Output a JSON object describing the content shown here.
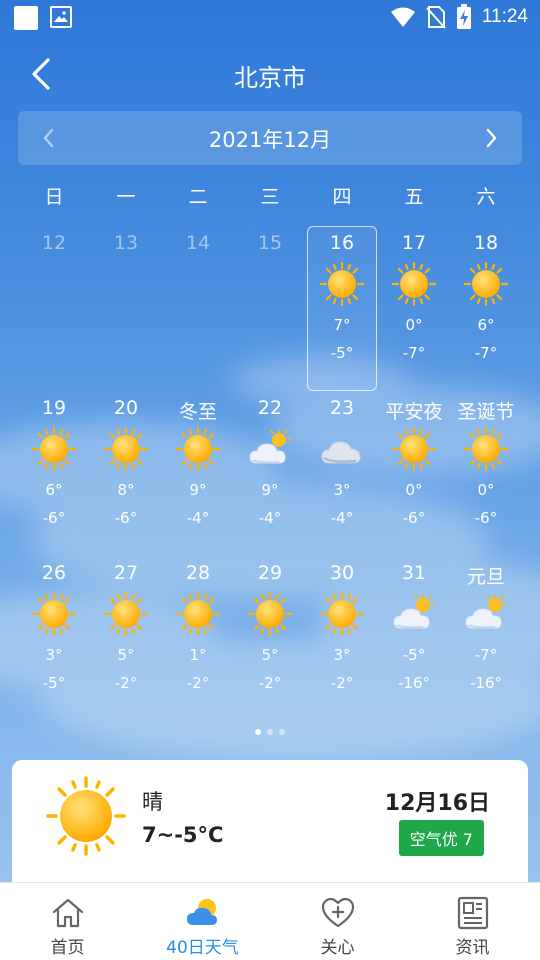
{
  "status_bar": {
    "time": "11:24"
  },
  "header": {
    "title": "北京市"
  },
  "calendar": {
    "month_label": "2021年12月",
    "weekdays": [
      "日",
      "一",
      "二",
      "三",
      "四",
      "五",
      "六"
    ],
    "days": [
      {
        "label": "12",
        "past": true
      },
      {
        "label": "13",
        "past": true
      },
      {
        "label": "14",
        "past": true
      },
      {
        "label": "15",
        "past": true
      },
      {
        "label": "16",
        "icon": "sun-icon",
        "high": "7°",
        "low": "-5°",
        "selected": true
      },
      {
        "label": "17",
        "icon": "sun-icon",
        "high": "0°",
        "low": "-7°"
      },
      {
        "label": "18",
        "icon": "sun-icon",
        "high": "6°",
        "low": "-7°"
      },
      {
        "label": "19",
        "icon": "sun-icon",
        "high": "6°",
        "low": "-6°"
      },
      {
        "label": "20",
        "icon": "sun-icon",
        "high": "8°",
        "low": "-6°"
      },
      {
        "label": "冬至",
        "icon": "sun-icon",
        "high": "9°",
        "low": "-4°"
      },
      {
        "label": "22",
        "icon": "partly-cloudy-icon",
        "high": "9°",
        "low": "-4°"
      },
      {
        "label": "23",
        "icon": "cloudy-icon",
        "high": "3°",
        "low": "-4°"
      },
      {
        "label": "平安夜",
        "icon": "sun-icon",
        "high": "0°",
        "low": "-6°"
      },
      {
        "label": "圣诞节",
        "icon": "sun-icon",
        "high": "0°",
        "low": "-6°"
      },
      {
        "label": "26",
        "icon": "sun-icon",
        "high": "3°",
        "low": "-5°"
      },
      {
        "label": "27",
        "icon": "sun-icon",
        "high": "5°",
        "low": "-2°"
      },
      {
        "label": "28",
        "icon": "sun-icon",
        "high": "1°",
        "low": "-2°"
      },
      {
        "label": "29",
        "icon": "sun-icon",
        "high": "5°",
        "low": "-2°"
      },
      {
        "label": "30",
        "icon": "sun-icon",
        "high": "3°",
        "low": "-2°"
      },
      {
        "label": "31",
        "icon": "partly-cloudy-icon",
        "high": "-5°",
        "low": "-16°"
      },
      {
        "label": "元旦",
        "icon": "partly-cloudy-icon",
        "high": "-7°",
        "low": "-16°"
      }
    ]
  },
  "pager": {
    "count": 3,
    "active": 0
  },
  "summary": {
    "condition": "晴",
    "range": "7~-5°C",
    "date": "12月16日",
    "aqi": "空气优 7"
  },
  "nav": {
    "items": [
      {
        "label": "首页",
        "icon": "home-icon",
        "active": false
      },
      {
        "label": "40日天气",
        "icon": "weather-icon",
        "active": true
      },
      {
        "label": "关心",
        "icon": "heart-plus-icon",
        "active": false
      },
      {
        "label": "资讯",
        "icon": "news-icon",
        "active": false
      }
    ]
  },
  "colors": {
    "accent": "#2a8fe6",
    "aqi_good": "#1ea84a",
    "sun": "#ffb300"
  }
}
